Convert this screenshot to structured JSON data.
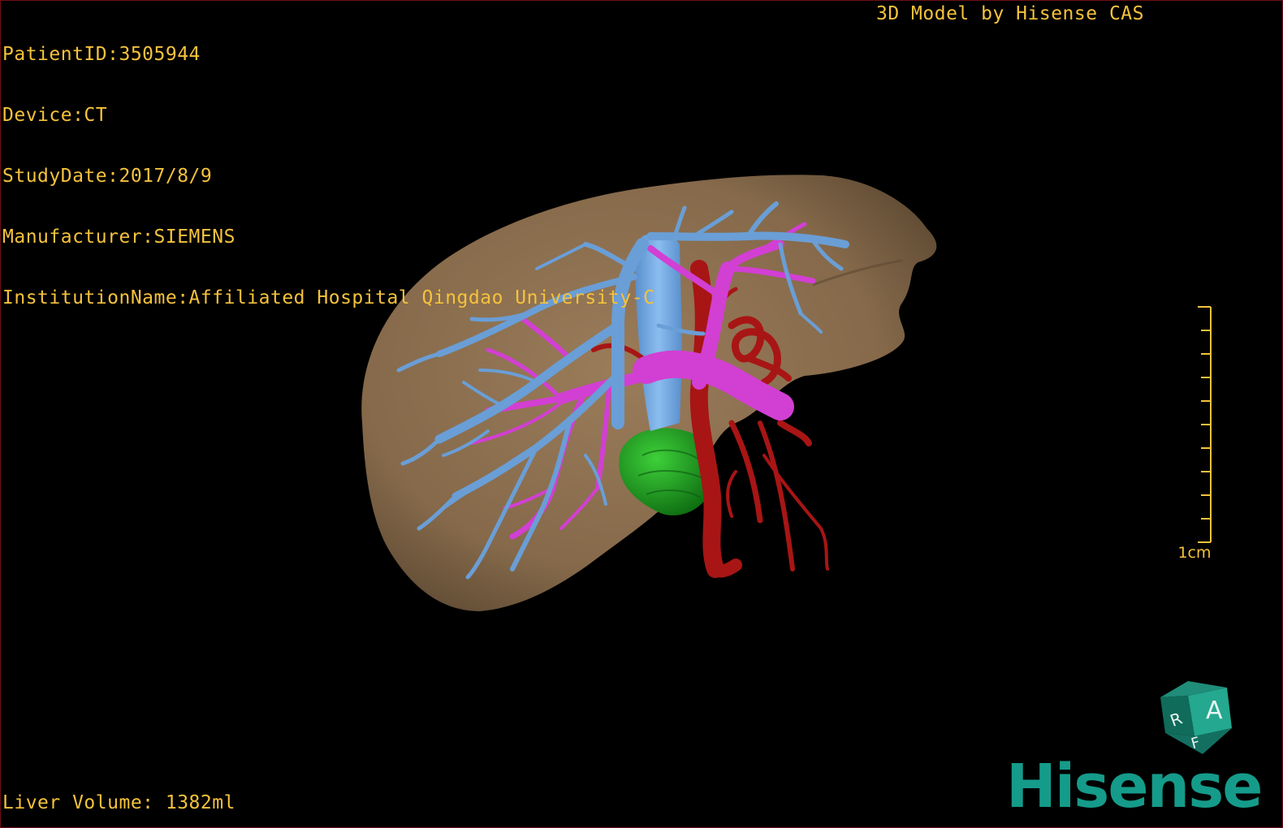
{
  "patient_info": {
    "patient_id": "PatientID:3505944",
    "device": "Device:CT",
    "study_date": "StudyDate:2017/8/9",
    "manufacturer": "Manufacturer:SIEMENS",
    "institution": "InstitutionName:Affiliated Hospital Qingdao University-C"
  },
  "model_credit": "3D Model by Hisense CAS",
  "liver_volume": "Liver Volume: 1382ml",
  "scale_bar": {
    "label": "1cm",
    "tick_count": 10
  },
  "orientation_cube": {
    "face_front": "A",
    "face_left": "R",
    "face_bottom": "F"
  },
  "brand_logo": "Hisense",
  "colors": {
    "background": "#000000",
    "overlay_text": "#f5c23c",
    "liver": "#8c7050",
    "portal_vein": "#6a9ed6",
    "hepatic_vein": "#d23fd3",
    "artery": "#a81515",
    "gallbladder": "#1c9e1f",
    "brand": "#159b8a",
    "viewport_border": "#6e0f14"
  }
}
